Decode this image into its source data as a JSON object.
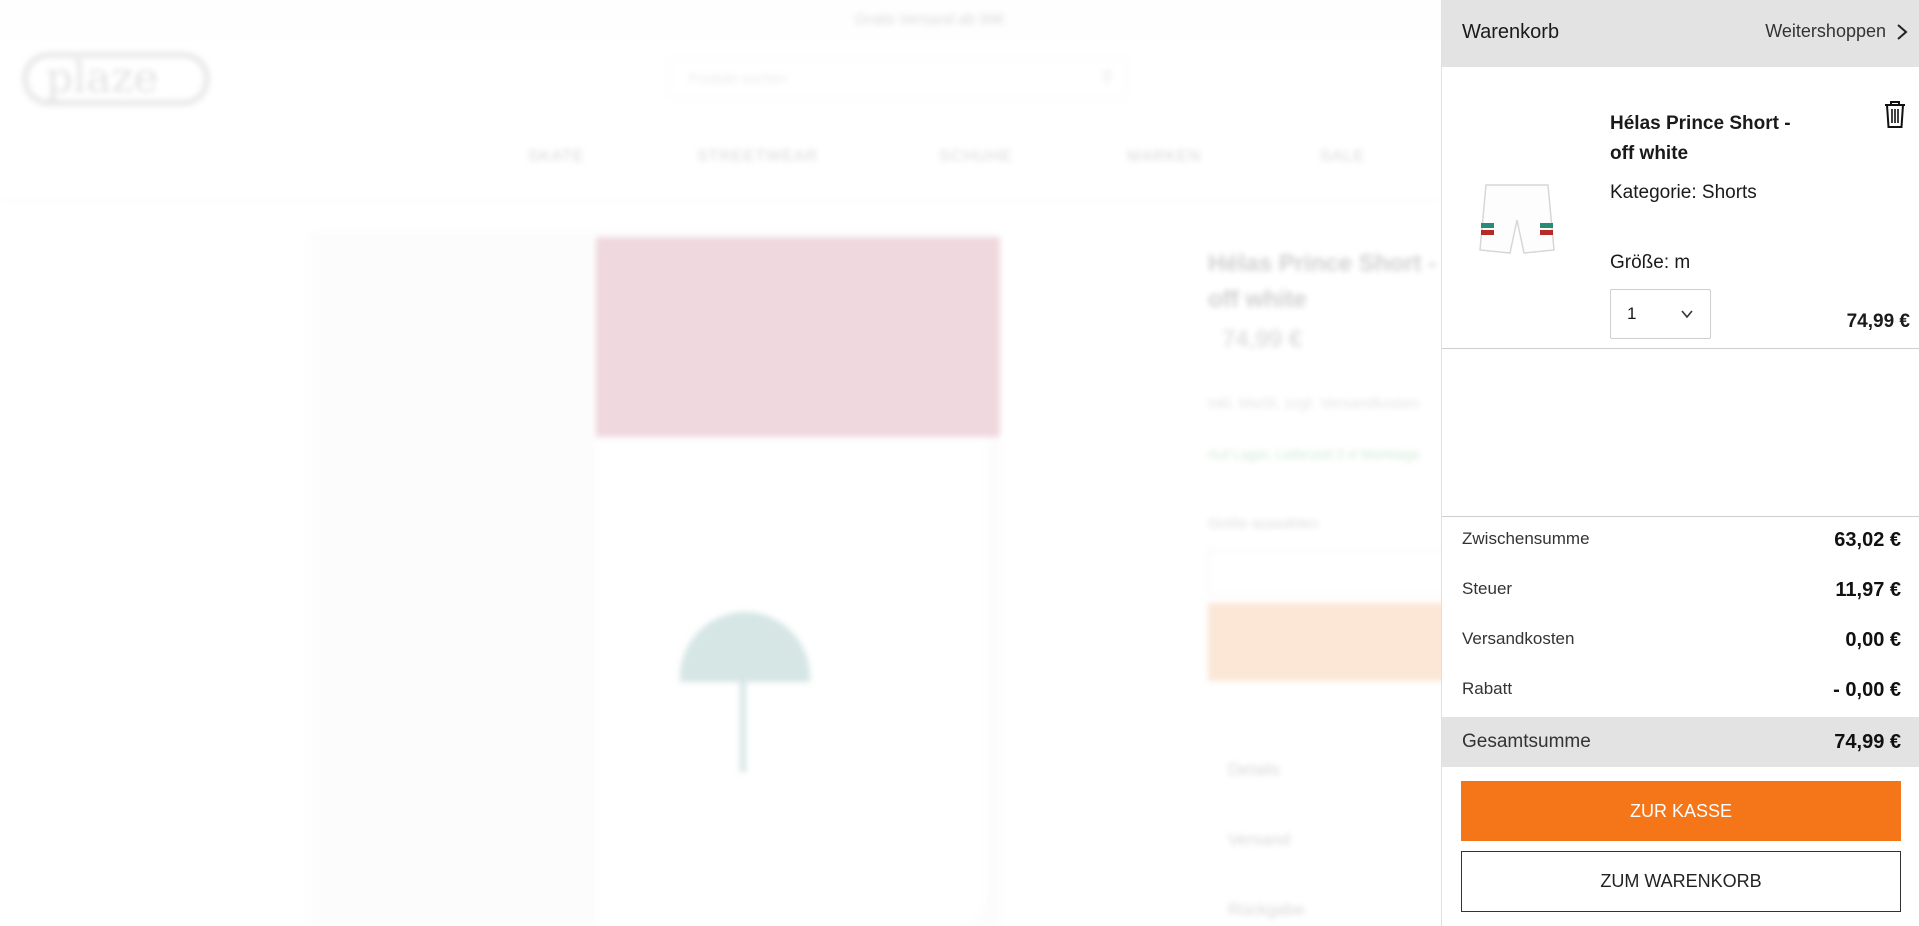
{
  "background": {
    "topbar_text": "Gratis Versand ab 99€",
    "logo_text": "plaze",
    "search_placeholder": "Produkt suchen",
    "nav": [
      "SKATE",
      "STREETWEAR",
      "SCHUHE",
      "MARKEN",
      "SALE"
    ],
    "product_title": "Hélas Prince Short - off white",
    "product_price": "74,99 €",
    "tax_note": "inkl. MwSt. zzgl. Versandkosten",
    "availability_note": "Auf Lager, Lieferzeit 2-4 Werktage",
    "size_label": "Größe auswählen",
    "accordion": [
      "Details",
      "Versand",
      "Rückgabe"
    ]
  },
  "cart": {
    "title": "Warenkorb",
    "continue_label": "Weitershoppen",
    "item": {
      "name": "Hélas Prince Short - off white",
      "category": "Kategorie: Shorts",
      "size": "Größe: m",
      "quantity": "1",
      "price": "74,99 €"
    },
    "totals": [
      {
        "label": "Zwischensumme",
        "value": "63,02 €"
      },
      {
        "label": "Steuer",
        "value": "11,97 €"
      },
      {
        "label": "Versandkosten",
        "value": "0,00 €"
      },
      {
        "label": "Rabatt",
        "value": "- 0,00 €"
      }
    ],
    "grand_total": {
      "label": "Gesamtsumme",
      "value": "74,99 €"
    },
    "checkout_label": "ZUR KASSE",
    "view_cart_label": "ZUM WARENKORB"
  },
  "colors": {
    "accent": "#f57519",
    "header_bg": "#e3e3e3"
  }
}
